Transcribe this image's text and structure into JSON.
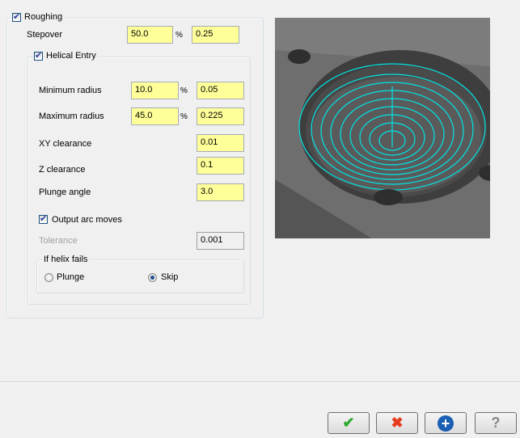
{
  "roughing": {
    "label": "Roughing",
    "checked": true,
    "stepover": {
      "label": "Stepover",
      "percent": "50.0",
      "value": "0.25",
      "unit": "%"
    },
    "helical": {
      "label": "Helical Entry",
      "checked": true,
      "min_radius": {
        "label": "Minimum radius",
        "percent": "10.0",
        "value": "0.05",
        "unit": "%"
      },
      "max_radius": {
        "label": "Maximum radius",
        "percent": "45.0",
        "value": "0.225",
        "unit": "%"
      },
      "xy_clearance": {
        "label": "XY clearance",
        "value": "0.01"
      },
      "z_clearance": {
        "label": "Z clearance",
        "value": "0.1"
      },
      "plunge_angle": {
        "label": "Plunge angle",
        "value": "3.0"
      },
      "output_arc": {
        "label": "Output arc moves",
        "checked": true
      },
      "tolerance": {
        "label": "Tolerance",
        "value": "0.001"
      },
      "fail": {
        "label": "If helix fails",
        "options": [
          "Plunge",
          "Skip"
        ],
        "selected": "Skip"
      }
    }
  },
  "buttons": [
    {
      "icon": "check-icon",
      "color": "#2fa82f"
    },
    {
      "icon": "x-icon",
      "color": "#e53a1e"
    },
    {
      "icon": "plus-icon",
      "color": "#1a5fb4"
    },
    {
      "icon": "help-icon",
      "color": "#888888"
    }
  ],
  "preview": {
    "toolpath_color": "#00e5e5"
  }
}
